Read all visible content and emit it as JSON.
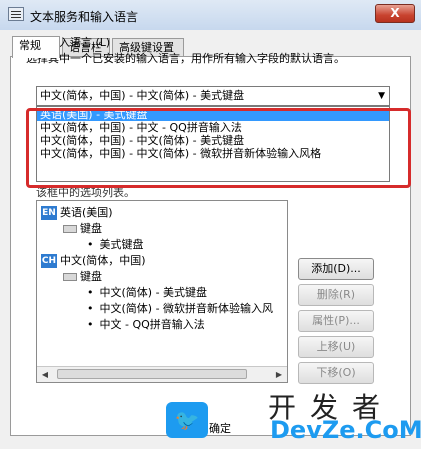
{
  "window": {
    "title": "文本服务和输入语言",
    "close_label": "X"
  },
  "tabs": [
    {
      "label": "常规"
    },
    {
      "label": "语言栏"
    },
    {
      "label": "高级键设置"
    }
  ],
  "default_input": {
    "group_label": "默认输入语言 (L)",
    "description": "选择其中一个已安装的输入语言，用作所有输入字段的默认语言。",
    "selected_value": "中文(简体，中国) - 中文(简体) - 美式键盘",
    "options": [
      "英语(美国) - 美式键盘",
      "中文(简体，中国) - 中文 - QQ拼音输入法",
      "中文(简体，中国) - 中文(简体) - 美式键盘",
      "中文(简体，中国) - 中文(简体) - 微软拼音新体验输入风格"
    ]
  },
  "installed": {
    "peek_label": "该框中的选项列表。",
    "tree": {
      "lang1": {
        "badge": "EN",
        "name": "英语(美国)",
        "keyboard_label": "键盘",
        "items": [
          "美式键盘"
        ]
      },
      "lang2": {
        "badge": "CH",
        "name": "中文(简体，中国)",
        "keyboard_label": "键盘",
        "items": [
          "中文(简体) - 美式键盘",
          "中文(简体) - 微软拼音新体验输入风",
          "中文 - QQ拼音输入法"
        ]
      }
    }
  },
  "buttons": {
    "add": "添加(D)...",
    "remove": "删除(R)",
    "properties": "属性(P)...",
    "move_up": "上移(U)",
    "move_down": "下移(O)",
    "ok": "确定"
  },
  "watermark": {
    "cn": "开发者",
    "en": "DevZe.CoM"
  },
  "colors": {
    "highlight_border": "#d62b2b",
    "selection": "#3399ff",
    "watermark_blue": "#1d9bf0"
  }
}
